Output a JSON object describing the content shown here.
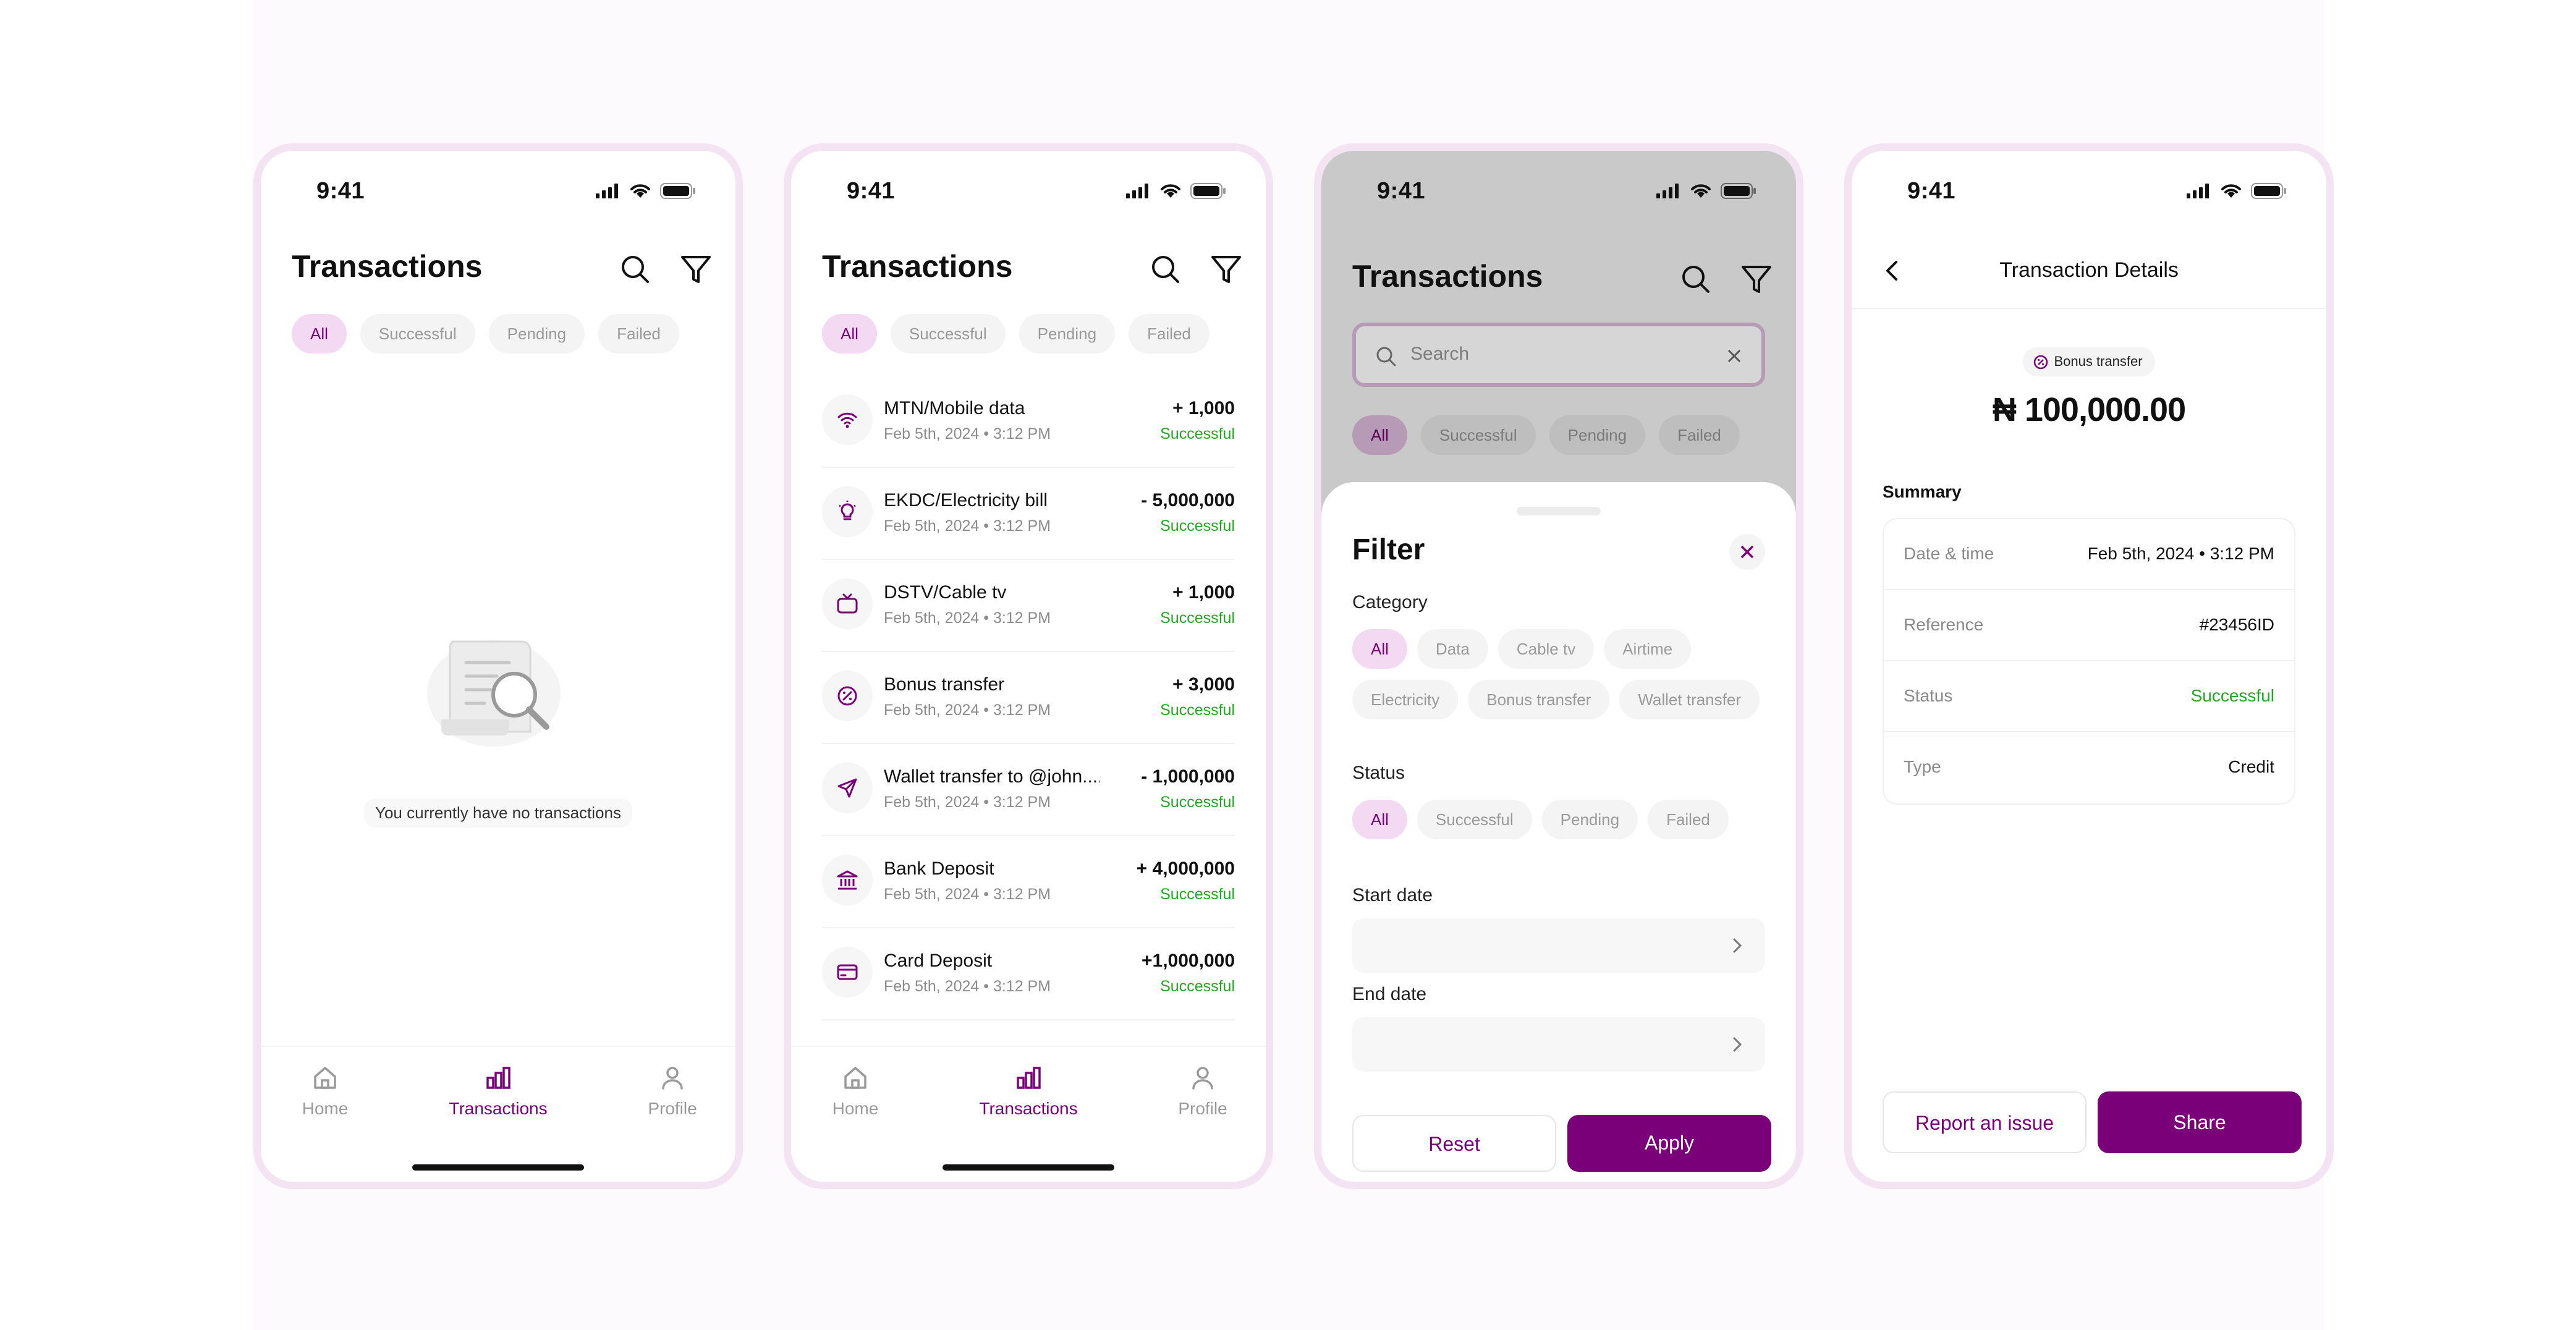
{
  "status_bar": {
    "time": "9:41"
  },
  "tabs": {
    "all": "All",
    "successful": "Successful",
    "pending": "Pending",
    "failed": "Failed"
  },
  "nav": {
    "home": "Home",
    "transactions": "Transactions",
    "profile": "Profile"
  },
  "screen1": {
    "title": "Transactions",
    "empty_message": "You currently have no transactions"
  },
  "screen2": {
    "title": "Transactions",
    "transactions": [
      {
        "name": "MTN/Mobile data",
        "date": "Feb 5th, 2024",
        "time": "3:12 PM",
        "amount": "+ 1,000",
        "status": "Successful",
        "icon": "wifi-icon"
      },
      {
        "name": "EKDC/Electricity bill",
        "date": "Feb 5th, 2024",
        "time": "3:12 PM",
        "amount": "- 5,000,000",
        "status": "Successful",
        "icon": "bulb-icon"
      },
      {
        "name": "DSTV/Cable tv",
        "date": "Feb 5th, 2024",
        "time": "3:12 PM",
        "amount": "+ 1,000",
        "status": "Successful",
        "icon": "tv-icon"
      },
      {
        "name": "Bonus transfer",
        "date": "Feb 5th, 2024",
        "time": "3:12 PM",
        "amount": "+ 3,000",
        "status": "Successful",
        "icon": "percent-icon"
      },
      {
        "name": "Wallet transfer to @john.....",
        "date": "Feb 5th, 2024",
        "time": "3:12 PM",
        "amount": "- 1,000,000",
        "status": "Successful",
        "icon": "send-icon"
      },
      {
        "name": "Bank Deposit",
        "date": "Feb 5th, 2024",
        "time": "3:12 PM",
        "amount": "+ 4,000,000",
        "status": "Successful",
        "icon": "bank-icon"
      },
      {
        "name": "Card Deposit",
        "date": "Feb 5th, 2024",
        "time": "3:12 PM",
        "amount": "+1,000,000",
        "status": "Successful",
        "icon": "card-icon"
      }
    ]
  },
  "screen3": {
    "title": "Transactions",
    "search_placeholder": "Search",
    "filter": {
      "title": "Filter",
      "category_label": "Category",
      "categories": [
        "All",
        "Data",
        "Cable tv",
        "Airtime",
        "Electricity",
        "Bonus transfer",
        "Wallet transfer"
      ],
      "status_label": "Status",
      "statuses": [
        "All",
        "Successful",
        "Pending",
        "Failed"
      ],
      "start_date_label": "Start date",
      "end_date_label": "End date",
      "reset_label": "Reset",
      "apply_label": "Apply"
    }
  },
  "screen4": {
    "title": "Transaction Details",
    "badge": "Bonus transfer",
    "amount": "₦ 100,000.00",
    "summary_label": "Summary",
    "rows": [
      {
        "key": "Date & time",
        "value": "Feb 5th, 2024 • 3:12 PM"
      },
      {
        "key": "Reference",
        "value": "#23456ID"
      },
      {
        "key": "Status",
        "value": "Successful"
      },
      {
        "key": "Type",
        "value": "Credit"
      }
    ],
    "report_label": "Report an issue",
    "share_label": "Share"
  },
  "colors": {
    "brand": "#7a007a",
    "brand_light": "#f3d9f1",
    "success": "#22a822",
    "frame": "#f4e4f3"
  }
}
